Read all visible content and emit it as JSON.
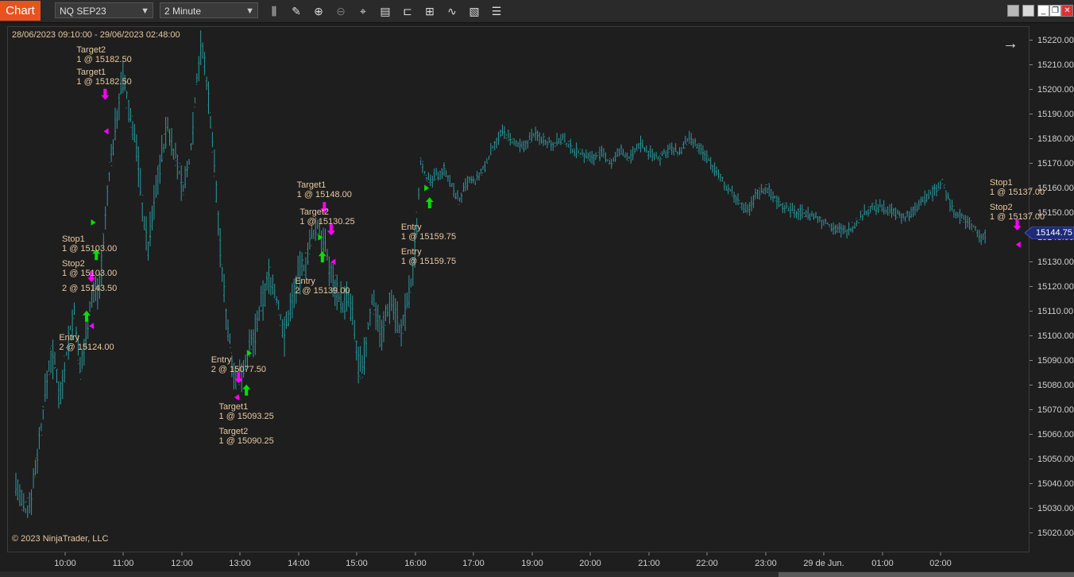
{
  "toolbar": {
    "tab_label": "Chart",
    "instrument": "NQ SEP23",
    "interval": "2 Minute",
    "icons": [
      "bars-type-icon",
      "draw-pencil-icon",
      "zoom-in-icon",
      "zoom-out-icon",
      "crosshair-icon",
      "data-box-icon",
      "templates-icon",
      "strategies-icon",
      "indicators-icon",
      "properties-icon",
      "list-icon"
    ]
  },
  "window": {
    "buttons": [
      "restore-icon",
      "tile-icon",
      "minimize-icon",
      "maximize-icon",
      "close-icon"
    ]
  },
  "chart": {
    "date_range": "28/06/2023 09:10:00 - 29/06/2023 02:48:00",
    "copyright": "© 2023 NinjaTrader, LLC",
    "last_price": "15144.75",
    "colors": {
      "bars": "#2a9aa0",
      "buy_arrow": "#00e000",
      "sell_arrow": "#ff00ff",
      "text": "#e8c9a0",
      "price_flag": "#1c2a78"
    }
  },
  "chart_data": {
    "type": "bar",
    "y_ticks": [
      "15220.00",
      "15210.00",
      "15200.00",
      "15190.00",
      "15180.00",
      "15170.00",
      "15160.00",
      "15150.00",
      "15140.00",
      "15130.00",
      "15120.00",
      "15110.00",
      "15100.00",
      "15090.00",
      "15080.00",
      "15070.00",
      "15060.00",
      "15050.00",
      "15040.00",
      "15030.00",
      "15020.00"
    ],
    "x_ticks": [
      "10:00",
      "11:00",
      "12:00",
      "13:00",
      "14:00",
      "15:00",
      "16:00",
      "17:00",
      "19:00",
      "20:00",
      "21:00",
      "22:00",
      "23:00",
      "29 de Jun.",
      "01:00",
      "02:00"
    ],
    "ylim": [
      15015,
      15228
    ],
    "price_path": [
      [
        "09:10",
        15040
      ],
      [
        "09:15",
        15032
      ],
      [
        "09:20",
        15028
      ],
      [
        "09:25",
        15035
      ],
      [
        "09:30",
        15048
      ],
      [
        "09:35",
        15062
      ],
      [
        "09:40",
        15078
      ],
      [
        "09:45",
        15092
      ],
      [
        "09:50",
        15088
      ],
      [
        "09:55",
        15075
      ],
      [
        "10:00",
        15090
      ],
      [
        "10:05",
        15102
      ],
      [
        "10:10",
        15110
      ],
      [
        "10:15",
        15085
      ],
      [
        "10:20",
        15096
      ],
      [
        "10:25",
        15112
      ],
      [
        "10:30",
        15118
      ],
      [
        "10:35",
        15120
      ],
      [
        "10:40",
        15140
      ],
      [
        "10:45",
        15165
      ],
      [
        "10:50",
        15180
      ],
      [
        "10:55",
        15195
      ],
      [
        "11:00",
        15205
      ],
      [
        "11:05",
        15192
      ],
      [
        "11:10",
        15185
      ],
      [
        "11:15",
        15170
      ],
      [
        "11:20",
        15150
      ],
      [
        "11:25",
        15135
      ],
      [
        "11:30",
        15150
      ],
      [
        "11:35",
        15165
      ],
      [
        "11:40",
        15175
      ],
      [
        "11:45",
        15185
      ],
      [
        "11:50",
        15178
      ],
      [
        "11:55",
        15170
      ],
      [
        "12:00",
        15160
      ],
      [
        "12:05",
        15165
      ],
      [
        "12:10",
        15180
      ],
      [
        "12:15",
        15205
      ],
      [
        "12:20",
        15218
      ],
      [
        "12:25",
        15205
      ],
      [
        "12:30",
        15185
      ],
      [
        "12:35",
        15160
      ],
      [
        "12:40",
        15130
      ],
      [
        "12:45",
        15110
      ],
      [
        "12:50",
        15095
      ],
      [
        "12:55",
        15082
      ],
      [
        "13:00",
        15085
      ],
      [
        "13:05",
        15090
      ],
      [
        "13:10",
        15095
      ],
      [
        "13:15",
        15100
      ],
      [
        "13:20",
        15110
      ],
      [
        "13:25",
        15118
      ],
      [
        "13:30",
        15125
      ],
      [
        "13:35",
        15118
      ],
      [
        "13:40",
        15110
      ],
      [
        "13:45",
        15100
      ],
      [
        "13:50",
        15110
      ],
      [
        "13:55",
        15118
      ],
      [
        "14:00",
        15125
      ],
      [
        "14:05",
        15128
      ],
      [
        "14:10",
        15135
      ],
      [
        "14:15",
        15142
      ],
      [
        "14:20",
        15145
      ],
      [
        "14:25",
        15138
      ],
      [
        "14:30",
        15130
      ],
      [
        "14:35",
        15122
      ],
      [
        "14:40",
        15118
      ],
      [
        "14:45",
        15112
      ],
      [
        "14:50",
        15115
      ],
      [
        "14:55",
        15108
      ],
      [
        "15:00",
        15090
      ],
      [
        "15:05",
        15085
      ],
      [
        "15:10",
        15100
      ],
      [
        "15:15",
        15115
      ],
      [
        "15:20",
        15110
      ],
      [
        "15:25",
        15100
      ],
      [
        "15:30",
        15110
      ],
      [
        "15:35",
        15115
      ],
      [
        "15:40",
        15108
      ],
      [
        "15:45",
        15100
      ],
      [
        "15:50",
        15112
      ],
      [
        "15:55",
        15120
      ],
      [
        "16:00",
        15140
      ],
      [
        "16:05",
        15172
      ],
      [
        "16:10",
        15165
      ],
      [
        "16:15",
        15162
      ],
      [
        "16:20",
        15165
      ],
      [
        "16:25",
        15166
      ],
      [
        "16:30",
        15168
      ],
      [
        "16:35",
        15162
      ],
      [
        "16:40",
        15158
      ],
      [
        "16:45",
        15155
      ],
      [
        "16:50",
        15160
      ],
      [
        "16:55",
        15163
      ],
      [
        "17:00",
        15162
      ],
      [
        "17:10",
        15168
      ],
      [
        "17:20",
        15178
      ],
      [
        "17:30",
        15183
      ],
      [
        "17:40",
        15178
      ],
      [
        "17:50",
        15176
      ],
      [
        "18:00",
        15182
      ],
      [
        "18:10",
        15180
      ],
      [
        "18:20",
        15178
      ],
      [
        "18:30",
        15180
      ],
      [
        "18:40",
        15176
      ],
      [
        "18:50",
        15174
      ],
      [
        "19:00",
        15172
      ],
      [
        "19:10",
        15174
      ],
      [
        "19:20",
        15170
      ],
      [
        "19:30",
        15175
      ],
      [
        "19:40",
        15172
      ],
      [
        "19:50",
        15178
      ],
      [
        "20:00",
        15174
      ],
      [
        "20:10",
        15172
      ],
      [
        "20:20",
        15176
      ],
      [
        "20:30",
        15174
      ],
      [
        "20:40",
        15180
      ],
      [
        "20:50",
        15176
      ],
      [
        "21:00",
        15172
      ],
      [
        "21:10",
        15165
      ],
      [
        "21:20",
        15160
      ],
      [
        "21:30",
        15155
      ],
      [
        "21:40",
        15150
      ],
      [
        "21:50",
        15158
      ],
      [
        "22:00",
        15160
      ],
      [
        "22:10",
        15155
      ],
      [
        "22:20",
        15152
      ],
      [
        "22:30",
        15150
      ],
      [
        "22:40",
        15150
      ],
      [
        "22:50",
        15148
      ],
      [
        "23:00",
        15146
      ],
      [
        "23:10",
        15144
      ],
      [
        "23:20",
        15142
      ],
      [
        "23:30",
        15145
      ],
      [
        "23:40",
        15150
      ],
      [
        "23:50",
        15152
      ],
      [
        "00:00",
        15152
      ],
      [
        "00:10",
        15150
      ],
      [
        "00:20",
        15148
      ],
      [
        "00:30",
        15150
      ],
      [
        "00:40",
        15155
      ],
      [
        "00:50",
        15158
      ],
      [
        "01:00",
        15162
      ],
      [
        "01:10",
        15152
      ],
      [
        "01:20",
        15148
      ],
      [
        "01:30",
        15145
      ],
      [
        "01:40",
        15140
      ],
      [
        "01:50",
        15142
      ],
      [
        "02:00",
        15146
      ],
      [
        "02:10",
        15148
      ],
      [
        "02:20",
        15140
      ],
      [
        "02:30",
        15138
      ],
      [
        "02:40",
        15142
      ],
      [
        "02:48",
        15145
      ]
    ],
    "annotations": [
      {
        "kind": "text",
        "lines": [
          "Target2",
          "1 @ 15182.50"
        ],
        "time": "10:40",
        "price": 15218
      },
      {
        "kind": "text",
        "lines": [
          "Target1",
          "1 @ 15182.50"
        ],
        "time": "10:40",
        "price": 15209
      },
      {
        "kind": "down",
        "time": "10:41",
        "price": 15198
      },
      {
        "kind": "tri-left",
        "time": "10:42",
        "price": 15183
      },
      {
        "kind": "tri-right",
        "time": "10:29",
        "price": 15146
      },
      {
        "kind": "text",
        "lines": [
          "Stop1",
          "1 @ 15103.00"
        ],
        "time": "10:25",
        "price": 15141
      },
      {
        "kind": "up",
        "time": "10:32",
        "price": 15133
      },
      {
        "kind": "text",
        "lines": [
          "Stop2",
          "1 @ 15103.00"
        ],
        "time": "10:25",
        "price": 15131
      },
      {
        "kind": "text",
        "lines": [
          "2 @ 15143.50"
        ],
        "time": "10:25",
        "price": 15121
      },
      {
        "kind": "down",
        "time": "10:27",
        "price": 15124
      },
      {
        "kind": "text",
        "lines": [
          "Entry",
          "2 @ 15124.00"
        ],
        "time": "10:22",
        "price": 15101
      },
      {
        "kind": "up",
        "time": "10:22",
        "price": 15108
      },
      {
        "kind": "tri-left",
        "time": "10:27",
        "price": 15104
      },
      {
        "kind": "text",
        "lines": [
          "Entry",
          "2 @ 15077.50"
        ],
        "time": "12:58",
        "price": 15092
      },
      {
        "kind": "tri-right",
        "time": "13:09",
        "price": 15093
      },
      {
        "kind": "down",
        "time": "12:58",
        "price": 15083
      },
      {
        "kind": "up",
        "time": "13:06",
        "price": 15078
      },
      {
        "kind": "tri-left",
        "time": "12:56",
        "price": 15075
      },
      {
        "kind": "text",
        "lines": [
          "Target1",
          "1 @ 15093.25"
        ],
        "time": "13:06",
        "price": 15073
      },
      {
        "kind": "text",
        "lines": [
          "Target2",
          "1 @ 15090.25"
        ],
        "time": "13:06",
        "price": 15063
      },
      {
        "kind": "text",
        "lines": [
          "Target1",
          "1 @ 15148.00"
        ],
        "time": "14:26",
        "price": 15163
      },
      {
        "kind": "down",
        "time": "14:26",
        "price": 15152
      },
      {
        "kind": "text",
        "lines": [
          "Target2",
          "1 @ 15130.25"
        ],
        "time": "14:29",
        "price": 15152
      },
      {
        "kind": "down",
        "time": "14:33",
        "price": 15143
      },
      {
        "kind": "tri-right",
        "time": "14:22",
        "price": 15140
      },
      {
        "kind": "up",
        "time": "14:24",
        "price": 15132
      },
      {
        "kind": "tri-left",
        "time": "14:35",
        "price": 15130
      },
      {
        "kind": "text",
        "lines": [
          "Entry",
          "2 @ 15139.00"
        ],
        "time": "14:24",
        "price": 15124
      },
      {
        "kind": "tri-right",
        "time": "16:11",
        "price": 15160
      },
      {
        "kind": "up",
        "time": "16:14",
        "price": 15154
      },
      {
        "kind": "text",
        "lines": [
          "Entry",
          "1 @ 15159.75"
        ],
        "time": "16:13",
        "price": 15146
      },
      {
        "kind": "text",
        "lines": [
          "Entry",
          "1 @ 15159.75"
        ],
        "time": "16:13",
        "price": 15136
      },
      {
        "kind": "text",
        "lines": [
          "Stop1",
          "1 @ 15137.00"
        ],
        "time": "02:17",
        "price": 15164
      },
      {
        "kind": "text",
        "lines": [
          "Stop2",
          "1 @ 15137.00"
        ],
        "time": "02:17",
        "price": 15154
      },
      {
        "kind": "down",
        "time": "02:17",
        "price": 15145
      },
      {
        "kind": "tri-left",
        "time": "02:18",
        "price": 15137
      }
    ]
  }
}
